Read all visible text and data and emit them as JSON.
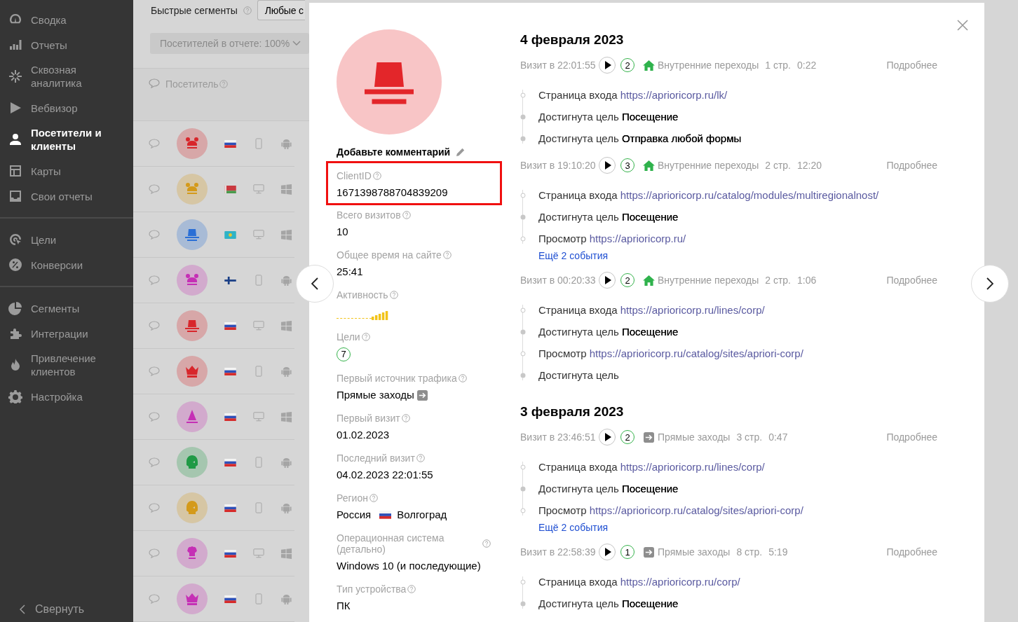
{
  "sidebar": {
    "groups": [
      {
        "items": [
          {
            "label": "Сводка",
            "selected": false
          },
          {
            "label": "Отчеты",
            "selected": false
          },
          {
            "label": "Сквозная аналитика",
            "selected": false
          },
          {
            "label": "Вебвизор",
            "selected": false
          },
          {
            "label": "Посетители и клиенты",
            "selected": true
          },
          {
            "label": "Карты",
            "selected": false
          },
          {
            "label": "Свои отчеты",
            "selected": false
          }
        ]
      },
      {
        "items": [
          {
            "label": "Цели",
            "selected": false
          },
          {
            "label": "Конверсии",
            "selected": false
          }
        ]
      },
      {
        "items": [
          {
            "label": "Сегменты",
            "selected": false
          },
          {
            "label": "Интеграции",
            "selected": false
          },
          {
            "label": "Привлечение клиентов",
            "selected": false
          },
          {
            "label": "Настройка",
            "selected": false
          }
        ]
      }
    ],
    "collapse": "Свернуть"
  },
  "toolbar": {
    "quick_segments": "Быстрые сегменты",
    "segment_button": "Любые с",
    "sample": "Посетителей в отчете: 100%"
  },
  "table": {
    "column": "Посетитель",
    "rows": [
      {
        "color": "#d8262b"
      },
      {
        "color": "#d49a1a"
      },
      {
        "color": "#2a6fd6"
      },
      {
        "color": "#c52fb5"
      },
      {
        "color": "#d8262b"
      },
      {
        "color": "#d8262b"
      },
      {
        "color": "#c52fb5"
      },
      {
        "color": "#1f9a45"
      },
      {
        "color": "#d49a1a"
      },
      {
        "color": "#c52fb5"
      },
      {
        "color": "#c52fb5"
      }
    ]
  },
  "visitor": {
    "color": "#e3262a",
    "comment": "Добавьте комментарий",
    "fields": [
      {
        "kind": "text",
        "label": "ClientID",
        "value": "1671398788704839209",
        "highlighted": true
      },
      {
        "kind": "text",
        "label": "Всего визитов",
        "value": "10",
        "highlighted": false
      },
      {
        "kind": "text",
        "label": "Общее время на сайте",
        "value": "25:41",
        "highlighted": false
      },
      {
        "kind": "activity",
        "label": "Активность",
        "level": 0.33,
        "highlighted": false
      },
      {
        "kind": "goals",
        "label": "Цели",
        "value": "7",
        "highlighted": false
      },
      {
        "kind": "source",
        "label": "Первый источник трафика",
        "value": "Прямые заходы",
        "highlighted": false
      },
      {
        "kind": "text",
        "label": "Первый визит",
        "value": "01.02.2023",
        "highlighted": false
      },
      {
        "kind": "text",
        "label": "Последний визит",
        "value": "04.02.2023 22:01:55",
        "highlighted": false
      },
      {
        "kind": "region",
        "label": "Регион",
        "value": "Россия",
        "city": "Волгоград",
        "highlighted": false
      },
      {
        "kind": "text",
        "label": "Операционная система (детально)",
        "value": "Windows 10 (и последующие)",
        "highlighted": false
      },
      {
        "kind": "text",
        "label": "Тип устройства",
        "value": "ПК",
        "highlighted": false
      }
    ]
  },
  "days": [
    {
      "date": "4 февраля 2023",
      "visits": [
        {
          "time": "Визит в 22:01:55",
          "goals": "2",
          "kind": "internal",
          "source": "Внутренние переходы",
          "pages": "1 стр.",
          "duration": "0:22",
          "details": "Подробнее",
          "events": [
            {
              "kind": "entry",
              "label": "Страница входа",
              "url": "https://aprioricorp.ru/lk/"
            },
            {
              "kind": "goal",
              "label": "Достигнута цель",
              "goal": "Посещение"
            },
            {
              "kind": "goal",
              "label": "Достигнута цель",
              "goal": "Отправка любой формы"
            }
          ]
        },
        {
          "time": "Визит в 19:10:20",
          "goals": "3",
          "kind": "internal",
          "source": "Внутренние переходы",
          "pages": "2 стр.",
          "duration": "12:20",
          "details": "Подробнее",
          "events": [
            {
              "kind": "entry",
              "label": "Страница входа",
              "url": "https://aprioricorp.ru/catalog/modules/multiregionalnost/"
            },
            {
              "kind": "goal",
              "label": "Достигнута цель",
              "goal": "Посещение"
            },
            {
              "kind": "view",
              "label": "Просмотр",
              "url": "https://aprioricorp.ru/"
            }
          ],
          "more": "Ещё 2 события"
        },
        {
          "time": "Визит в 00:20:33",
          "goals": "2",
          "kind": "internal",
          "source": "Внутренние переходы",
          "pages": "2 стр.",
          "duration": "1:06",
          "details": "Подробнее",
          "events": [
            {
              "kind": "entry",
              "label": "Страница входа",
              "url": "https://aprioricorp.ru/lines/corp/"
            },
            {
              "kind": "goal",
              "label": "Достигнута цель",
              "goal": "Посещение"
            },
            {
              "kind": "view",
              "label": "Просмотр",
              "url": "https://aprioricorp.ru/catalog/sites/apriori-corp/"
            },
            {
              "kind": "goal",
              "label": "Достигнута цель"
            }
          ]
        }
      ]
    },
    {
      "date": "3 февраля 2023",
      "visits": [
        {
          "time": "Визит в 23:46:51",
          "goals": "2",
          "kind": "direct",
          "source": "Прямые заходы",
          "pages": "3 стр.",
          "duration": "0:47",
          "details": "Подробнее",
          "events": [
            {
              "kind": "entry",
              "label": "Страница входа",
              "url": "https://aprioricorp.ru/lines/corp/"
            },
            {
              "kind": "goal",
              "label": "Достигнута цель",
              "goal": "Посещение"
            },
            {
              "kind": "view",
              "label": "Просмотр",
              "url": "https://aprioricorp.ru/catalog/sites/apriori-corp/"
            }
          ],
          "more": "Ещё 2 события"
        },
        {
          "time": "Визит в 22:58:39",
          "goals": "1",
          "kind": "direct",
          "source": "Прямые заходы",
          "pages": "8 стр.",
          "duration": "5:19",
          "details": "Подробнее",
          "events": [
            {
              "kind": "entry",
              "label": "Страница входа",
              "url": "https://aprioricorp.ru/corp/"
            },
            {
              "kind": "goal",
              "label": "Достигнута цель",
              "goal": "Посещение"
            }
          ]
        }
      ]
    }
  ]
}
